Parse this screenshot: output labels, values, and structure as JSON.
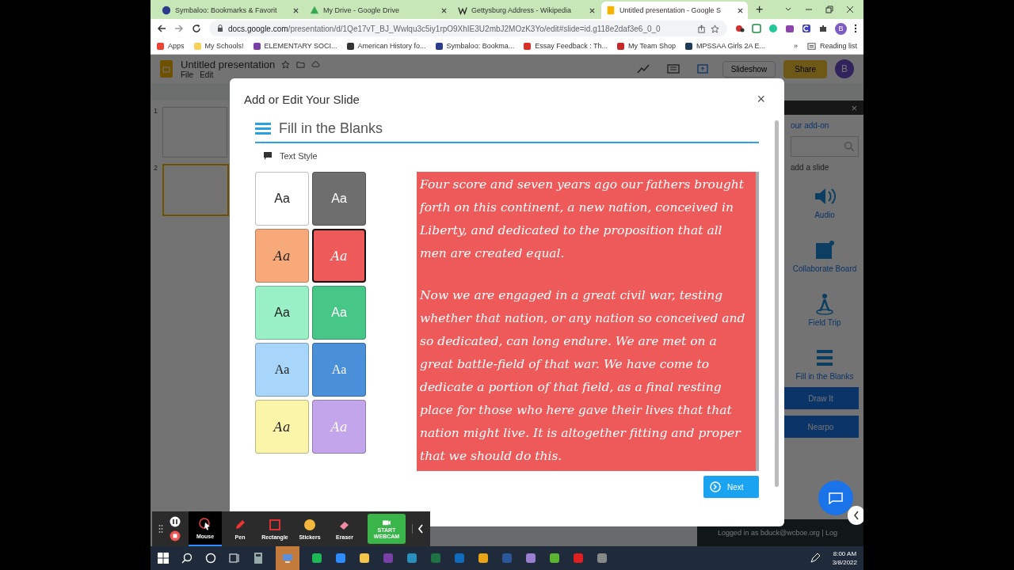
{
  "browser": {
    "tabs": [
      {
        "title": "Symbaloo: Bookmarks & Favorit",
        "kind": "symbaloo",
        "selected": false
      },
      {
        "title": "My Drive - Google Drive",
        "kind": "drive",
        "selected": false
      },
      {
        "title": "Gettysburg Address - Wikipedia",
        "kind": "wiki",
        "selected": false
      },
      {
        "title": "Untitled presentation - Google S",
        "kind": "slides",
        "selected": true
      }
    ],
    "new_tab": "+",
    "url_host": "docs.google.com",
    "url_path": "/presentation/d/1Qe17vT_BJ_Wwlqu3c5iy1rpO9XhIE3U2mbJ2MOzK3Yo/edit#slide=id.g118e2daf3e6_0_0",
    "profile": "B",
    "bookmarks": [
      {
        "label": "Apps",
        "color": "#ea4335"
      },
      {
        "label": "My Schools!",
        "color": "#f6d15a"
      },
      {
        "label": "ELEMENTARY SOCI...",
        "color": "#7b3fa8"
      },
      {
        "label": "American History fo...",
        "color": "#333333"
      },
      {
        "label": "Symbaloo: Bookma...",
        "color": "#2b3a8c"
      },
      {
        "label": "Essay Feedback : Th...",
        "color": "#d93025"
      },
      {
        "label": "My Team Shop",
        "color": "#c62828"
      },
      {
        "label": "MPSSAA Girls 2A E...",
        "color": "#1f3b57"
      }
    ],
    "more": "»",
    "reading_list": "Reading list"
  },
  "slides_app": {
    "title": "Untitled presentation",
    "menu": [
      "File",
      "Edit"
    ],
    "slideshow": "Slideshow",
    "share": "Share",
    "avatar": "B",
    "slides": [
      {
        "number": "1",
        "selected": false
      },
      {
        "number": "2",
        "selected": true
      }
    ]
  },
  "addon_panel": {
    "close": "×",
    "link": "our add-on",
    "hint": "add a slide",
    "items": [
      {
        "label": "Audio",
        "kind": "audio"
      },
      {
        "label": "Collaborate Board",
        "kind": "board"
      },
      {
        "label": "Field Trip",
        "kind": "trip"
      },
      {
        "label": "Fill in the Blanks",
        "kind": "blanks"
      }
    ],
    "buttons": [
      "Draw It",
      "Nearpo"
    ],
    "footer": "Logged in as bduck@wcboe.org | Log"
  },
  "dialog": {
    "title": "Add or Edit Your Slide",
    "close": "×",
    "heading": "Fill in the Blanks",
    "section": "Text Style",
    "styles": [
      {
        "label": "Aa",
        "color": "#ffffff",
        "light_text": false,
        "kind": "sans",
        "selected": false
      },
      {
        "label": "Aa",
        "color": "#6e6e6e",
        "light_text": true,
        "kind": "sans",
        "selected": false
      },
      {
        "label": "Aa",
        "color": "#f7a97a",
        "light_text": false,
        "kind": "script",
        "selected": false
      },
      {
        "label": "Aa",
        "color": "#ee5a5a",
        "light_text": true,
        "kind": "script",
        "selected": true
      },
      {
        "label": "Aa",
        "color": "#9af0c6",
        "light_text": false,
        "kind": "sans",
        "selected": false
      },
      {
        "label": "Aa",
        "color": "#47c787",
        "light_text": true,
        "kind": "sans",
        "selected": false
      },
      {
        "label": "Aa",
        "color": "#a8d6fa",
        "light_text": false,
        "kind": "serif",
        "selected": false
      },
      {
        "label": "Aa",
        "color": "#4a90d9",
        "light_text": true,
        "kind": "serif",
        "selected": false
      },
      {
        "label": "Aa",
        "color": "#fbf5aa",
        "light_text": false,
        "kind": "script",
        "selected": false
      },
      {
        "label": "Aa",
        "color": "#c3a5ec",
        "light_text": true,
        "kind": "script",
        "selected": false
      }
    ],
    "preview": [
      "Four score and seven years ago our fathers brought forth on this continent, a new nation, conceived in Liberty, and dedicated to the proposition that all men are created equal.",
      "Now we are engaged in a great civil war, testing whether that nation, or any nation so conceived and so dedicated, can long endure. We are met on a great battle-field of that war. We have come to dedicate a portion of that field, as a final resting place for those who here gave their lives that that nation might live. It is altogether fitting and proper that we should do this."
    ],
    "next": "Next"
  },
  "recorder": {
    "tools": [
      {
        "label": "Mouse",
        "kind": "mouse",
        "selected": true
      },
      {
        "label": "Pen",
        "kind": "pen",
        "selected": false
      },
      {
        "label": "Rectangle",
        "kind": "rect",
        "selected": false
      },
      {
        "label": "Stickers",
        "kind": "stickers",
        "selected": false
      },
      {
        "label": "Eraser",
        "kind": "eraser",
        "selected": false
      }
    ],
    "webcam": "START WEBCAM"
  },
  "taskbar": {
    "time": "8:00 AM",
    "date": "3/8/2022"
  }
}
